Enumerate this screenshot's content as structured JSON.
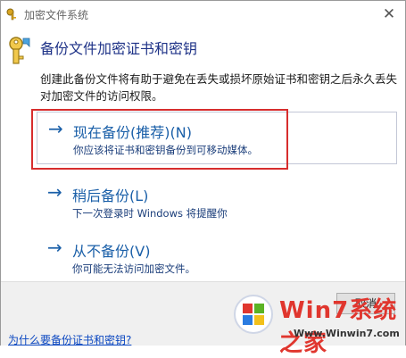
{
  "window": {
    "title": "加密文件系统",
    "close_glyph": "✕"
  },
  "header": {
    "heading": "备份文件加密证书和密钥",
    "description": "创建此备份文件将有助于避免在丢失或损坏原始证书和密钥之后永久丢失对加密文件的访问权限。"
  },
  "options": [
    {
      "arrow": "→",
      "title": "现在备份(推荐)(N)",
      "subtitle": "你应该将证书和密钥备份到可移动媒体。"
    },
    {
      "arrow": "→",
      "title": "稍后备份(L)",
      "subtitle": "下一次登录时 Windows 将提醒你"
    },
    {
      "arrow": "→",
      "title": "从不备份(V)",
      "subtitle": "你可能无法访问加密文件。"
    }
  ],
  "footer": {
    "cancel_label": "取消",
    "help_link": "为什么要备份证书和密钥?"
  },
  "watermark": {
    "brand": "Win7系统之家",
    "url": "Www.Winwin7.com"
  },
  "colors": {
    "heading": "#1e3287",
    "option_link": "#1a5fa8",
    "highlight_outline": "#d72d2d",
    "help_link": "#0b47c1"
  },
  "icons": {
    "title": "key-icon",
    "header": "key-icon"
  }
}
